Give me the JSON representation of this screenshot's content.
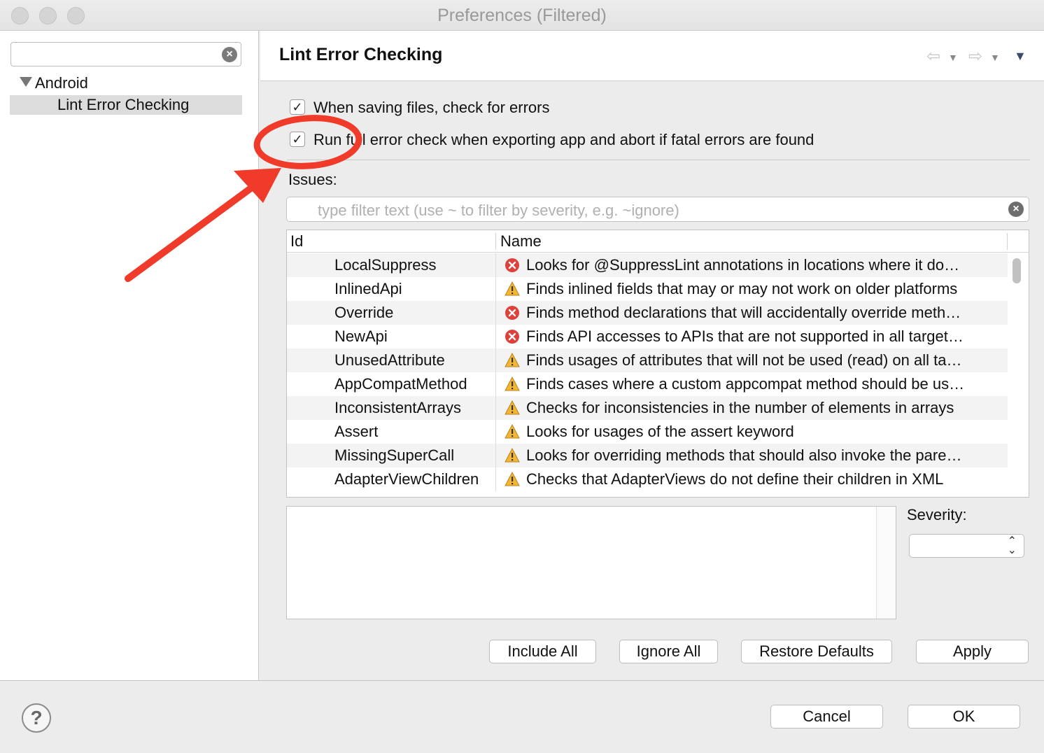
{
  "window": {
    "title": "Preferences (Filtered)"
  },
  "sidebar": {
    "search_value": "",
    "tree": [
      {
        "label": "Android",
        "expanded": true
      },
      {
        "label": "Lint Error Checking",
        "selected": true
      }
    ]
  },
  "main": {
    "title": "Lint Error Checking",
    "checkboxes": [
      {
        "label": "When saving files, check for errors",
        "checked": true
      },
      {
        "label": "Run full error check when exporting app and abort if fatal errors are found",
        "checked": true
      }
    ],
    "issues_label": "Issues:",
    "filter_placeholder": "type filter text (use ~ to filter by severity, e.g. ~ignore)",
    "table": {
      "columns": [
        "Id",
        "Name"
      ],
      "rows": [
        {
          "id": "LocalSuppress",
          "severity": "error",
          "name": "Looks for @SuppressLint annotations in locations where it do…"
        },
        {
          "id": "InlinedApi",
          "severity": "warning",
          "name": "Finds inlined fields that may or may not work on older platforms"
        },
        {
          "id": "Override",
          "severity": "error",
          "name": "Finds method declarations that will accidentally override meth…"
        },
        {
          "id": "NewApi",
          "severity": "error",
          "name": "Finds API accesses to APIs that are not supported in all target…"
        },
        {
          "id": "UnusedAttribute",
          "severity": "warning",
          "name": "Finds usages of attributes that will not be used (read) on all ta…"
        },
        {
          "id": "AppCompatMethod",
          "severity": "warning",
          "name": "Finds cases where a custom appcompat method should be us…"
        },
        {
          "id": "InconsistentArrays",
          "severity": "warning",
          "name": "Checks for inconsistencies in the number of elements in arrays"
        },
        {
          "id": "Assert",
          "severity": "warning",
          "name": "Looks for usages of the assert keyword"
        },
        {
          "id": "MissingSuperCall",
          "severity": "warning",
          "name": "Looks for overriding methods that should also invoke the pare…"
        },
        {
          "id": "AdapterViewChildren",
          "severity": "warning",
          "name": "Checks that AdapterViews do not define their children in XML"
        }
      ]
    },
    "severity_label": "Severity:",
    "severity_value": "",
    "buttons": {
      "include_all": "Include All",
      "ignore_all": "Ignore All",
      "restore_defaults": "Restore Defaults",
      "apply": "Apply"
    }
  },
  "footer": {
    "cancel": "Cancel",
    "ok": "OK",
    "help_glyph": "?"
  },
  "colors": {
    "error": "#e0403a",
    "warning": "#f2b632",
    "annotation": "#f03a2a"
  }
}
